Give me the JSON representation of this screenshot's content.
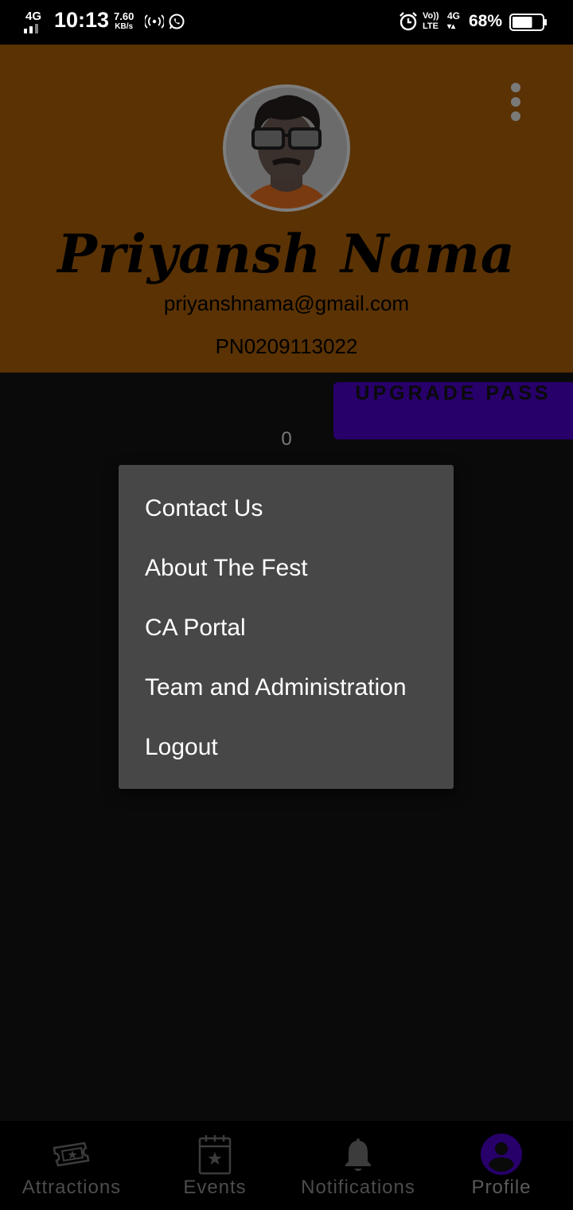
{
  "status_bar": {
    "network": "4G",
    "time": "10:13",
    "speed_value": "7.60",
    "speed_unit": "KB/s",
    "volte_top": "Vo))",
    "volte_bottom": "LTE",
    "network2": "4G",
    "battery": "68%",
    "battery_level": 0.68,
    "icons": [
      "signal-icon",
      "hotspot-icon",
      "whatsapp-icon",
      "alarm-icon",
      "battery-icon"
    ]
  },
  "profile": {
    "name": "Priyansh Nama",
    "email": "priyanshnama@gmail.com",
    "id": "PN0209113022",
    "header_color": "#5a3204"
  },
  "actions": {
    "upgrade_label": "UPGRADE PASS",
    "upgrade_color": "#27006a",
    "count": "0"
  },
  "menu": {
    "items": [
      {
        "label": "Contact Us"
      },
      {
        "label": "About The Fest"
      },
      {
        "label": "CA Portal"
      },
      {
        "label": "Team and Administration"
      },
      {
        "label": "Logout"
      }
    ]
  },
  "bottom_nav": {
    "items": [
      {
        "label": "Attractions",
        "icon": "ticket-icon"
      },
      {
        "label": "Events",
        "icon": "calendar-star-icon"
      },
      {
        "label": "Notifications",
        "icon": "bell-icon"
      },
      {
        "label": "Profile",
        "icon": "profile-icon",
        "active": true
      }
    ],
    "active_color": "#27006a"
  }
}
